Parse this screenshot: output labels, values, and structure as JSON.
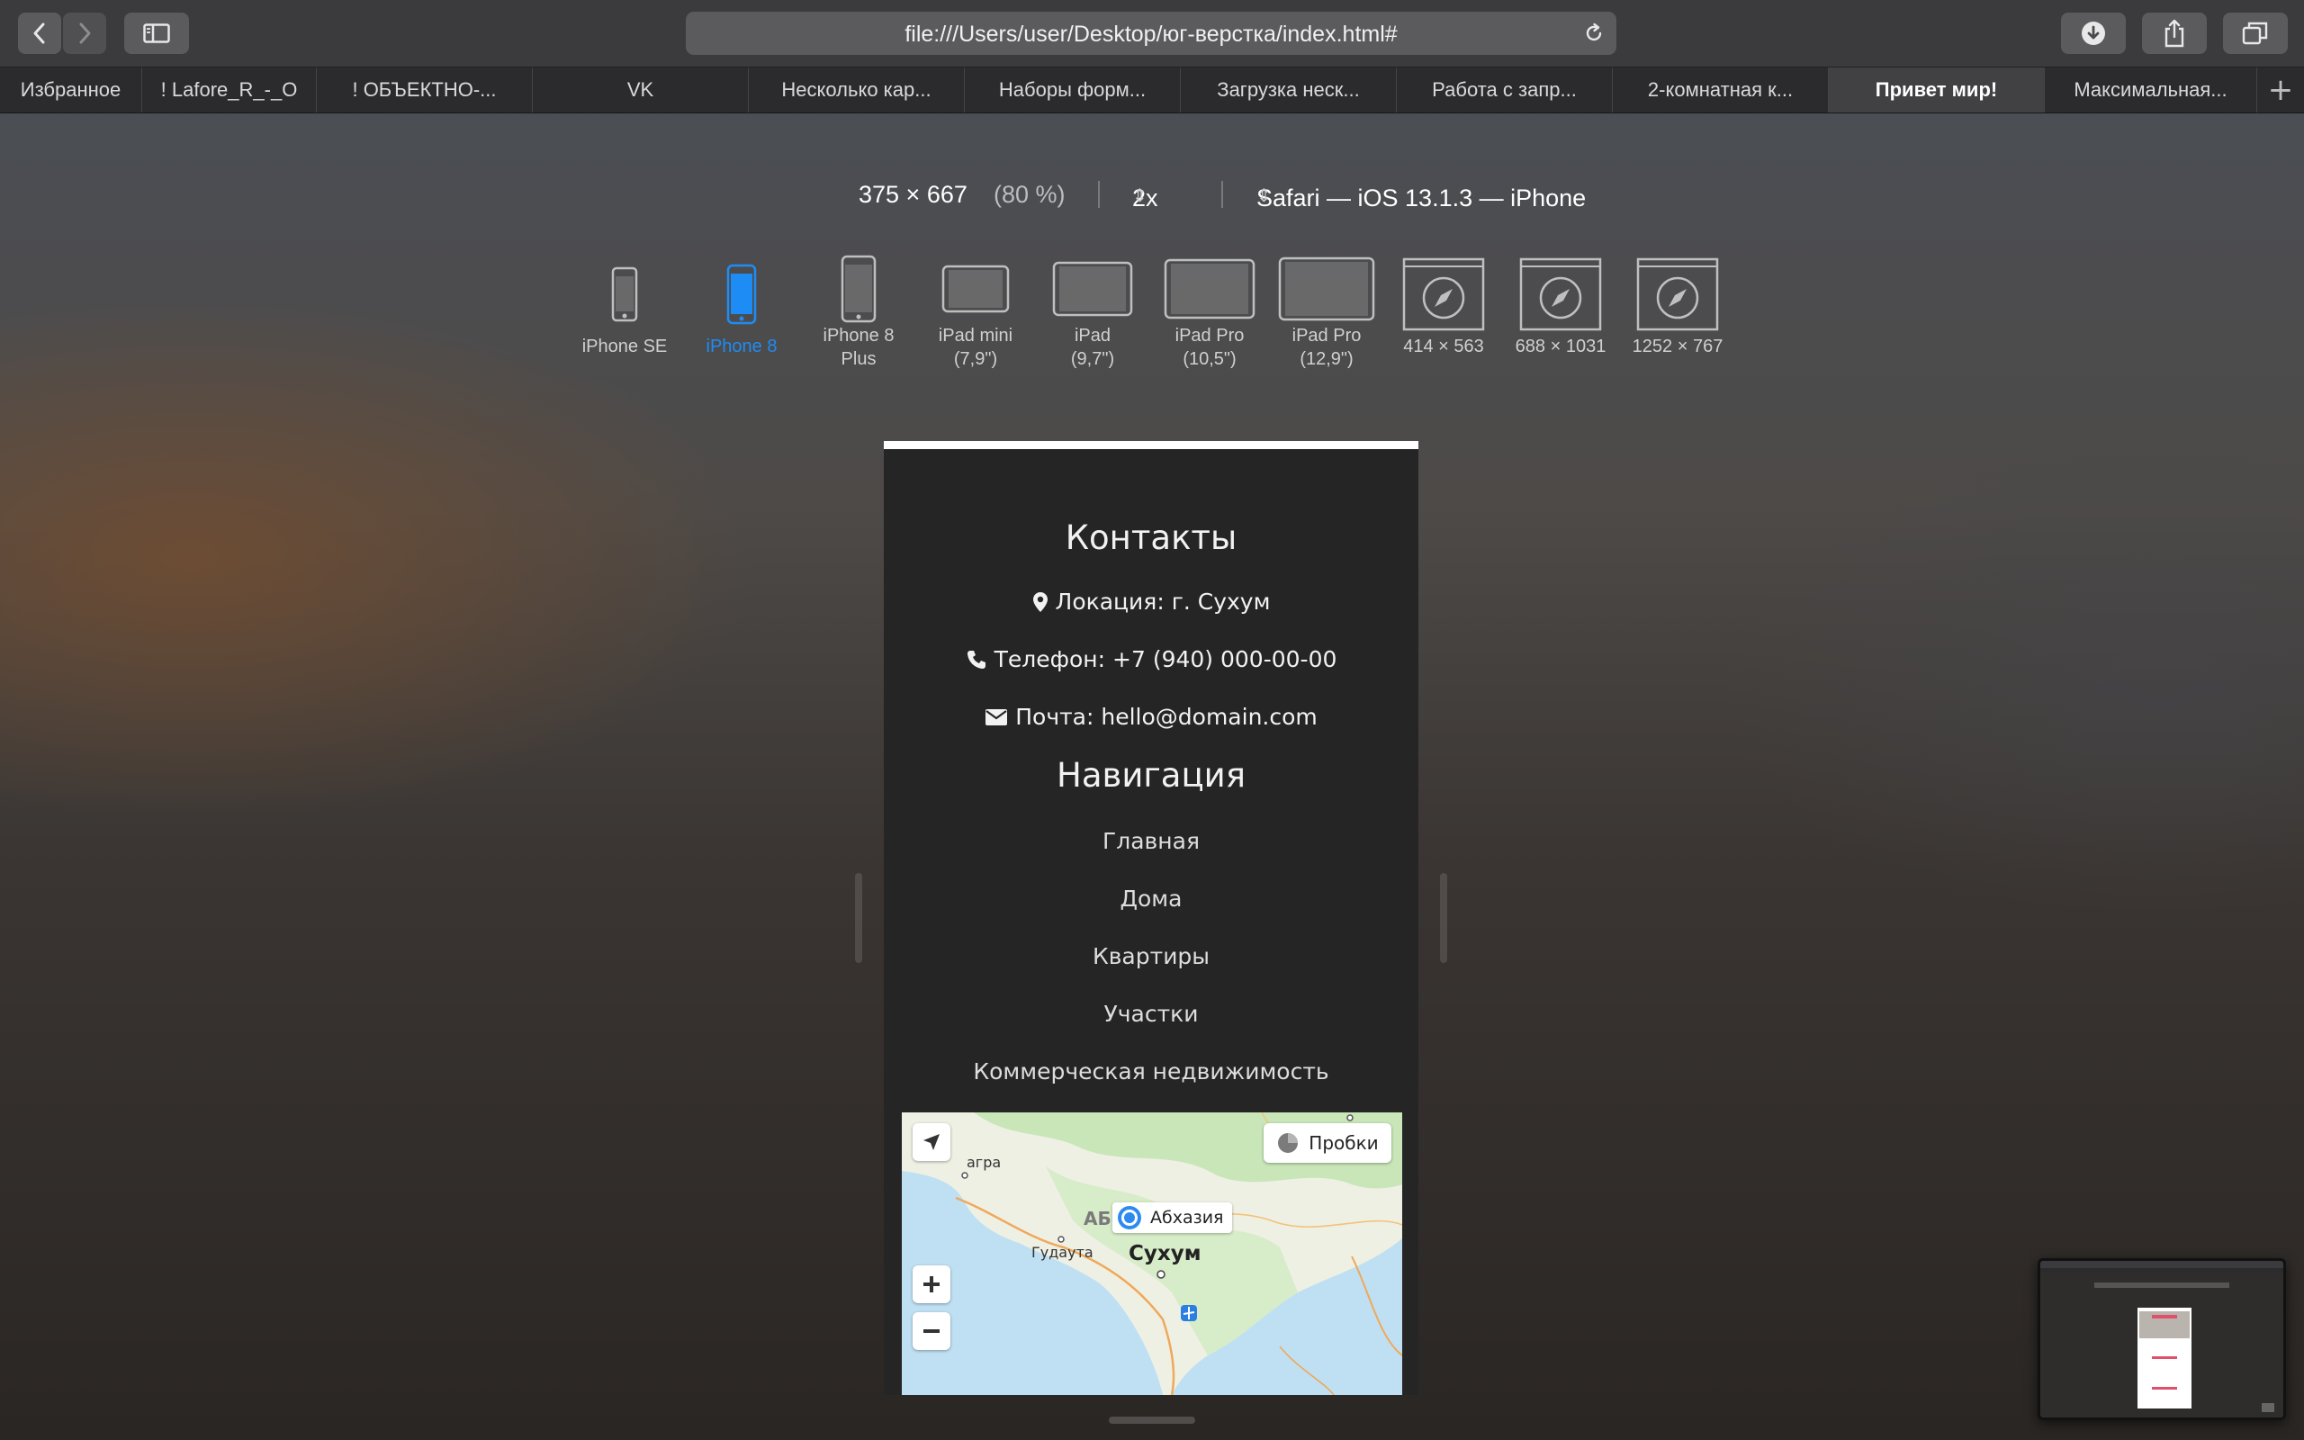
{
  "toolbar": {
    "url": "file:///Users/user/Desktop/юг-верстка/index.html#"
  },
  "tabs": [
    {
      "label": "Избранное"
    },
    {
      "label": "! Lafore_R_-_O"
    },
    {
      "label": "! ОБЪЕКТНО-..."
    },
    {
      "label": "VK"
    },
    {
      "label": "Несколько кар..."
    },
    {
      "label": "Наборы форм..."
    },
    {
      "label": "Загрузка неск..."
    },
    {
      "label": "Работа с запр..."
    },
    {
      "label": "2-комнатная к..."
    },
    {
      "label": "Привет мир!",
      "active": true
    },
    {
      "label": "Максимальная..."
    }
  ],
  "responsive": {
    "size": "375 × 667",
    "zoom": "(80 %)",
    "scale": "2x",
    "agent": "Safari — iOS 13.1.3 — iPhone",
    "devices": [
      {
        "line1": "iPhone SE",
        "line2": ""
      },
      {
        "line1": "iPhone 8",
        "line2": "",
        "selected": true
      },
      {
        "line1": "iPhone 8",
        "line2": "Plus"
      },
      {
        "line1": "iPad mini",
        "line2": "(7,9\")"
      },
      {
        "line1": "iPad",
        "line2": "(9,7\")"
      },
      {
        "line1": "iPad Pro",
        "line2": "(10,5\")"
      },
      {
        "line1": "iPad Pro",
        "line2": "(12,9\")"
      },
      {
        "line1": "414 × 563",
        "line2": ""
      },
      {
        "line1": "688 × 1031",
        "line2": ""
      },
      {
        "line1": "1252 × 767",
        "line2": ""
      }
    ]
  },
  "page": {
    "contacts_title": "Контакты",
    "location": "Локация: г. Сухум",
    "phone": "Телефон: +7 (940) 000-00-00",
    "email": "Почта: hello@domain.com",
    "nav_title": "Навигация",
    "nav": [
      "Главная",
      "Дома",
      "Квартиры",
      "Участки",
      "Коммерческая недвижимость"
    ]
  },
  "map": {
    "traffic": "Пробки",
    "labels": {
      "region": "Абхазия",
      "region_faded": "АБ",
      "city": "Сухум",
      "gudauta": "Гудаута",
      "gagra": "агра"
    }
  }
}
